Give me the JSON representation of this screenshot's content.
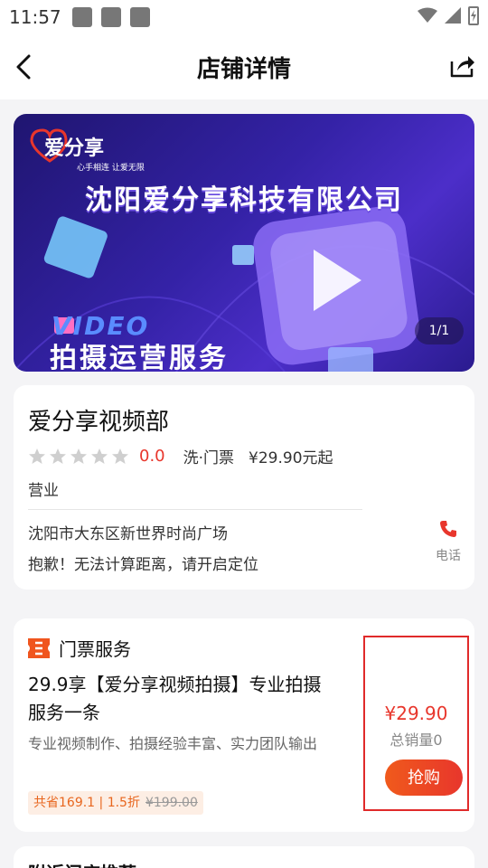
{
  "status_bar": {
    "time": "11:57"
  },
  "header": {
    "title": "店铺详情"
  },
  "banner": {
    "logo_text": "爱分享",
    "logo_sub": "心手相连 让爱无限",
    "title": "沈阳爱分享科技有限公司",
    "video_label": "VIDEO",
    "service_text": "拍摄运营服务",
    "page_indicator": "1/1"
  },
  "store": {
    "name": "爱分享视频部",
    "rating": "0.0",
    "tag": "洗·门票",
    "price_from": "¥29.90元起",
    "status": "营业",
    "address": "沈阳市大东区新世界时尚广场",
    "distance_note": "抱歉！无法计算距离，请开启定位",
    "phone_label": "电话"
  },
  "ticket_section": {
    "title": "门票服务",
    "product": {
      "title": "29.9享【爱分享视频拍摄】专业拍摄服务一条",
      "description": "专业视频制作、拍摄经验丰富、实力团队输出",
      "discount": "共省169.1 | 1.5折",
      "original_price": "¥199.00",
      "price": "¥29.90",
      "sales": "总销量0",
      "buy_label": "抢购"
    }
  },
  "next_section": {
    "title": "附近门店推荐"
  },
  "colors": {
    "accent": "#e8362c",
    "buy_button": "#f05a1c",
    "highlight_box": "#e02a2a"
  }
}
